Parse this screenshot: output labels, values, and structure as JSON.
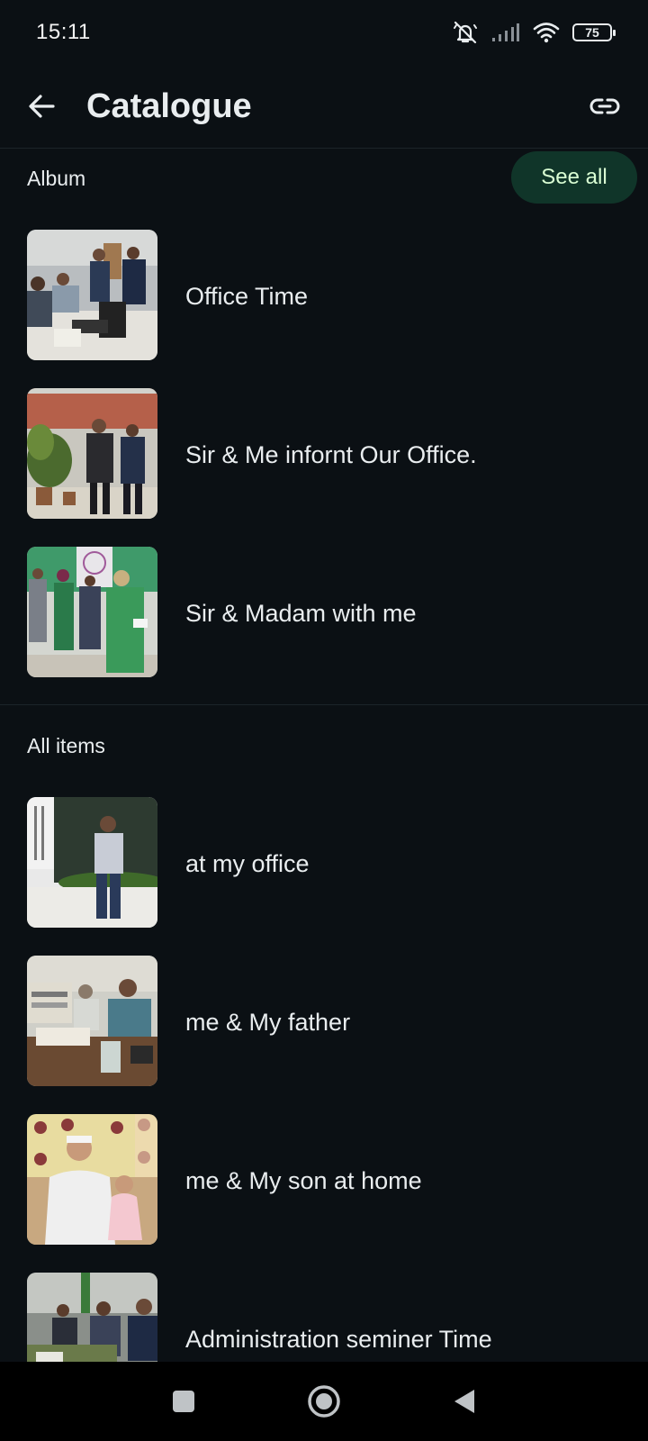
{
  "status": {
    "time": "15:11",
    "battery": "75"
  },
  "header": {
    "title": "Catalogue"
  },
  "album": {
    "heading": "Album",
    "see_all": "See all",
    "items": [
      {
        "label": "Office Time"
      },
      {
        "label": "Sir & Me infornt Our Office."
      },
      {
        "label": "Sir & Madam with me"
      }
    ]
  },
  "all_items": {
    "heading": "All items",
    "items": [
      {
        "label": "at my office"
      },
      {
        "label": "me & My father"
      },
      {
        "label": "me & My son at home"
      },
      {
        "label": "Administration seminer Time"
      }
    ]
  },
  "icons": {
    "back": "arrow-back-icon",
    "link": "link-icon",
    "mute": "bell-off-icon",
    "signal": "signal-icon",
    "wifi": "wifi-icon",
    "nav_recents": "square-icon",
    "nav_home": "circle-icon",
    "nav_back": "triangle-back-icon"
  },
  "colors": {
    "background": "#0b1014",
    "accent_pill": "#103529",
    "accent_text": "#d9fdd3"
  }
}
